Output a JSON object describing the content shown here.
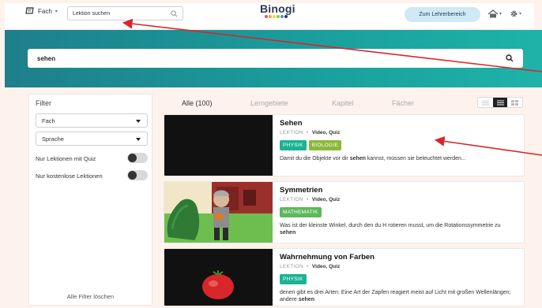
{
  "header": {
    "subject_label": "Fach",
    "lesson_search_placeholder": "Lektion suchen",
    "logo_text": "Binogi",
    "logo_dot_colors": [
      "#e94e77",
      "#f5a623",
      "#f8d12f",
      "#7ed321",
      "#4a90e2",
      "#2b3a55"
    ],
    "teacher_button": "Zum Lehrerbereich"
  },
  "search": {
    "query": "sehen"
  },
  "filter": {
    "title": "Filter",
    "subject_select": "Fach",
    "language_select": "Sprache",
    "quiz_only_label": "Nur Lektionen mit Quiz",
    "free_only_label": "Nur kostenlose Lektionen",
    "clear_label": "Alle Filter löschen"
  },
  "tabs": [
    {
      "label": "Alle (100)",
      "active": true
    },
    {
      "label": "Lerngebiete",
      "active": false
    },
    {
      "label": "Kapitel",
      "active": false
    },
    {
      "label": "Fächer",
      "active": false
    }
  ],
  "results": [
    {
      "title": "Sehen",
      "type": "LEKTION",
      "formats": "Video, Quiz",
      "tags": [
        "PHYSIK",
        "BIOLOGIE"
      ],
      "desc_pre": "Damit du die Objekte vor dir ",
      "desc_bold": "sehen",
      "desc_post": " kannst, müssen sie beleuchtet werden..."
    },
    {
      "title": "Symmetrien",
      "type": "LEKTION",
      "formats": "Video, Quiz",
      "tags": [
        "MATHEMATIK"
      ],
      "desc_pre": "Was ist der kleinste Winkel, durch den du H rotieren musst, um die Rotationssymmetrie zu ",
      "desc_bold": "sehen",
      "desc_post": ""
    },
    {
      "title": "Wahrnehmung von Farben",
      "type": "LEKTION",
      "formats": "Video, Quiz",
      "tags": [
        "PHYSIK"
      ],
      "desc_pre": "denen gibt es drei Arten: Eine Art der Zapfen reagiert meist auf Licht mit großen Wellenlängen; andere ",
      "desc_bold": "sehen",
      "desc_post": ""
    }
  ],
  "colors": {
    "band": "#1aa09e",
    "physik": "#1ab394",
    "biologie": "#8ab83a",
    "annotation": "#d8262b"
  }
}
